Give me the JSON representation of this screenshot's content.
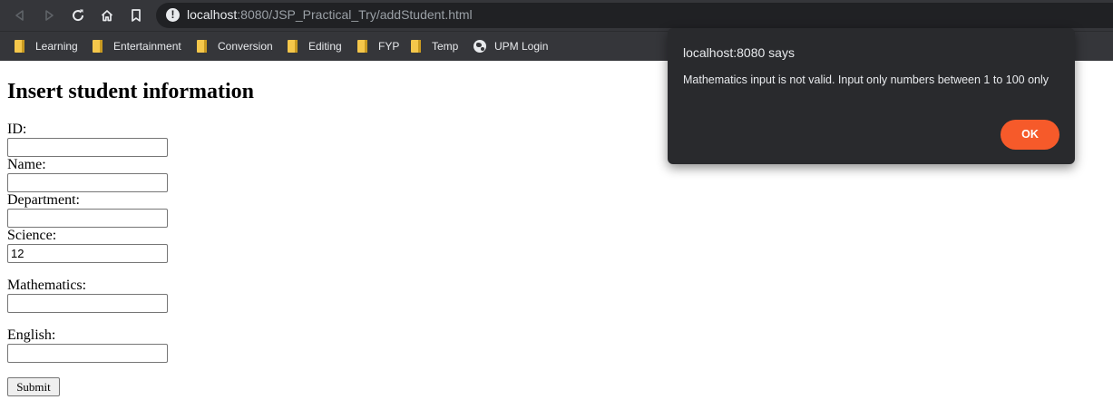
{
  "browser": {
    "url": {
      "host": "localhost",
      "rest": ":8080/JSP_Practical_Try/addStudent.html"
    },
    "bookmarks": [
      {
        "label": "Learning",
        "icon": "folder-icon"
      },
      {
        "label": "Entertainment",
        "icon": "folder-icon"
      },
      {
        "label": "Conversion",
        "icon": "folder-icon"
      },
      {
        "label": "Editing",
        "icon": "folder-icon"
      },
      {
        "label": "FYP",
        "icon": "folder-icon"
      },
      {
        "label": "Temp",
        "icon": "folder-icon"
      },
      {
        "label": "UPM Login",
        "icon": "globe-icon"
      }
    ]
  },
  "page": {
    "heading": "Insert student information",
    "fields": {
      "id": {
        "label": "ID:",
        "value": ""
      },
      "name": {
        "label": "Name:",
        "value": ""
      },
      "department": {
        "label": "Department:",
        "value": ""
      },
      "science": {
        "label": "Science:",
        "value": "12"
      },
      "mathematics": {
        "label": "Mathematics:",
        "value": ""
      },
      "english": {
        "label": "English:",
        "value": ""
      }
    },
    "submit_label": "Submit"
  },
  "dialog": {
    "title": "localhost:8080 says",
    "message": "Mathematics input is not valid. Input only numbers between 1 to 100 only",
    "ok_label": "OK",
    "accent_color": "#f65a2a"
  }
}
